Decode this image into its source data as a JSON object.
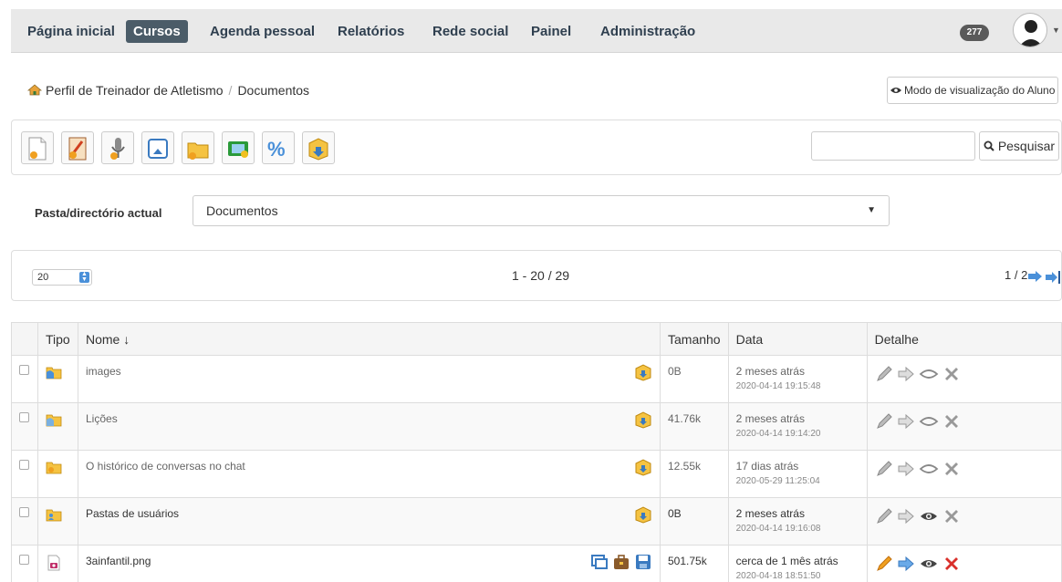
{
  "nav": {
    "items": [
      {
        "label": "Página inicial",
        "active": false
      },
      {
        "label": "Cursos",
        "active": true
      },
      {
        "label": "Agenda pessoal",
        "active": false
      },
      {
        "label": "Relatórios",
        "active": false
      },
      {
        "label": "Rede social",
        "active": false
      },
      {
        "label": "Painel",
        "active": false
      },
      {
        "label": "Administração",
        "active": false
      }
    ],
    "badge": "277",
    "avatar_icon": "user-avatar-icon"
  },
  "breadcrumb": {
    "home_icon": "home-icon",
    "items": [
      "Perfil de Treinador de Atletismo",
      "Documentos"
    ],
    "separator": "/"
  },
  "student_view": {
    "icon": "eye-icon",
    "label": "Modo de visualização do Aluno"
  },
  "toolbar": {
    "tools": [
      "new-document-icon",
      "new-drawing-icon",
      "record-audio-icon",
      "upload-icon",
      "new-folder-icon",
      "slideshow-icon",
      "quota-icon",
      "download-all-icon"
    ],
    "search_placeholder": "",
    "search_label": "Pesquisar"
  },
  "folder": {
    "label": "Pasta/directório actual",
    "selected": "Documentos"
  },
  "pager": {
    "per_page": "20",
    "range": "1 - 20 / 29",
    "page": "1 / 2"
  },
  "table": {
    "headers": {
      "type": "Tipo",
      "name": "Nome ↓",
      "size": "Tamanho",
      "date": "Data",
      "detail": "Detalhe"
    },
    "rows": [
      {
        "name": "images",
        "size": "0B",
        "date_rel": "2 meses atrás",
        "date_abs": "2020-04-14 19:15:48",
        "kind": "folder",
        "visible": false
      },
      {
        "name": "Lições",
        "size": "41.76k",
        "date_rel": "2 meses atrás",
        "date_abs": "2020-04-14 19:14:20",
        "kind": "folder",
        "visible": false
      },
      {
        "name": "O histórico de conversas no chat",
        "size": "12.55k",
        "date_rel": "17 dias atrás",
        "date_abs": "2020-05-29 11:25:04",
        "kind": "folder-chat",
        "visible": false
      },
      {
        "name": "Pastas de usuários",
        "size": "0B",
        "date_rel": "2 meses atrás",
        "date_abs": "2020-04-14 19:16:08",
        "kind": "folder-users",
        "visible": true
      },
      {
        "name": "3ainfantil.png",
        "size": "501.75k",
        "date_rel": "cerca de 1 mês atrás",
        "date_abs": "2020-04-18 18:51:50",
        "kind": "image",
        "visible": true
      }
    ]
  },
  "colors": {
    "nav_bg": "#e9e9e9",
    "nav_active": "#4b5c68",
    "accent_blue": "#4a90d9",
    "folder_yellow": "#f5c342",
    "delete_red": "#d9302b"
  }
}
